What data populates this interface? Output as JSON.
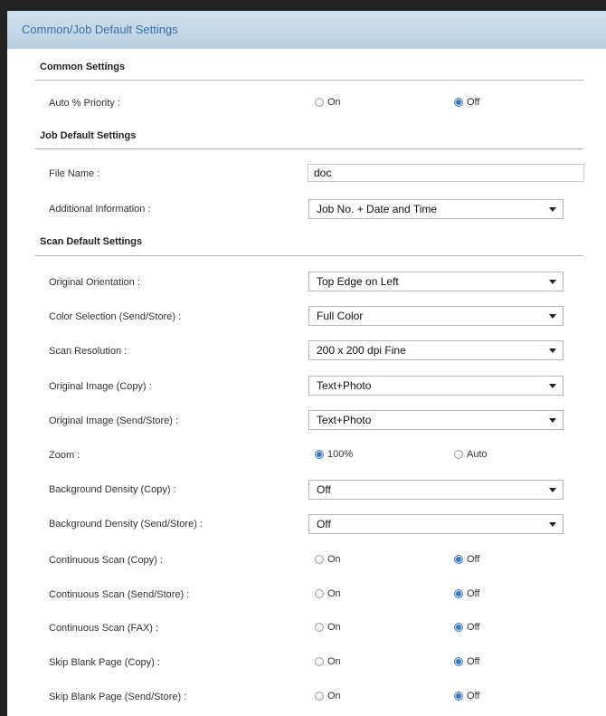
{
  "panel": {
    "title": "Common/Job Default Settings"
  },
  "common": {
    "title": "Common Settings",
    "auto_priority": {
      "label": "Auto % Priority :",
      "on": "On",
      "off": "Off",
      "selected": "off"
    }
  },
  "job": {
    "title": "Job Default Settings",
    "file_name": {
      "label": "File Name :",
      "value": "doc"
    },
    "additional_info": {
      "label": "Additional Information :",
      "value": "Job No. + Date and Time"
    }
  },
  "scan": {
    "title": "Scan Default Settings",
    "original_orientation": {
      "label": "Original Orientation :",
      "value": "Top Edge on Left"
    },
    "color_selection": {
      "label": "Color Selection (Send/Store) :",
      "value": "Full Color"
    },
    "scan_resolution": {
      "label": "Scan Resolution :",
      "value": "200 x 200 dpi Fine"
    },
    "original_image_copy": {
      "label": "Original Image (Copy) :",
      "value": "Text+Photo"
    },
    "original_image_send": {
      "label": "Original Image (Send/Store) :",
      "value": "Text+Photo"
    },
    "zoom": {
      "label": "Zoom :",
      "opt1": "100%",
      "opt2": "Auto",
      "selected": "100%"
    },
    "bg_density_copy": {
      "label": "Background Density (Copy) :",
      "value": "Off"
    },
    "bg_density_send": {
      "label": "Background Density (Send/Store) :",
      "value": "Off"
    },
    "continuous_copy": {
      "label": "Continuous Scan (Copy) :",
      "on": "On",
      "off": "Off",
      "selected": "off"
    },
    "continuous_send": {
      "label": "Continuous Scan (Send/Store) :",
      "on": "On",
      "off": "Off",
      "selected": "off"
    },
    "continuous_fax": {
      "label": "Continuous Scan (FAX) :",
      "on": "On",
      "off": "Off",
      "selected": "off"
    },
    "skip_blank_copy": {
      "label": "Skip Blank Page (Copy) :",
      "on": "On",
      "off": "Off",
      "selected": "off"
    },
    "skip_blank_send": {
      "label": "Skip Blank Page (Send/Store) :",
      "on": "On",
      "off": "Off",
      "selected": "off"
    }
  }
}
